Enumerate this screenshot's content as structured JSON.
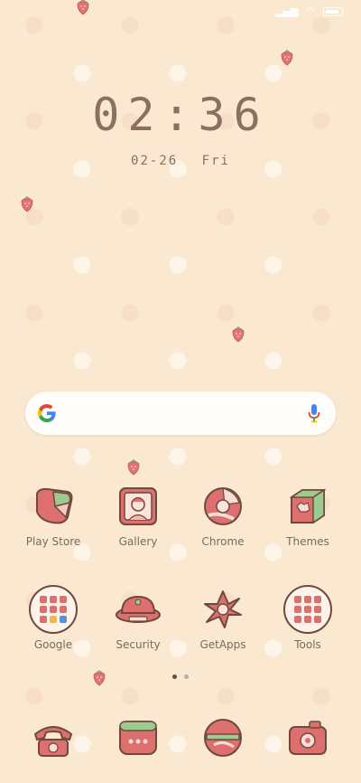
{
  "status_bar": {
    "signal_icon": "signal-icon",
    "wifi_icon": "wifi-icon",
    "battery_icon": "battery-icon"
  },
  "clock": {
    "time": "02:36",
    "date": "02-26",
    "weekday": "Fri"
  },
  "search": {
    "logo_icon": "google-g-icon",
    "mic_icon": "mic-icon"
  },
  "apps": [
    {
      "label": "Play Store",
      "icon": "play-store-icon"
    },
    {
      "label": "Gallery",
      "icon": "gallery-icon"
    },
    {
      "label": "Chrome",
      "icon": "chrome-icon"
    },
    {
      "label": "Themes",
      "icon": "themes-icon"
    },
    {
      "label": "Google",
      "icon": "google-folder-icon"
    },
    {
      "label": "Security",
      "icon": "security-icon"
    },
    {
      "label": "GetApps",
      "icon": "getapps-icon"
    },
    {
      "label": "Tools",
      "icon": "tools-folder-icon"
    }
  ],
  "page_indicator": {
    "pages": 2,
    "current": 1
  },
  "dock": [
    {
      "icon": "phone-icon"
    },
    {
      "icon": "messages-icon"
    },
    {
      "icon": "browser-icon"
    },
    {
      "icon": "camera-icon"
    }
  ],
  "colors": {
    "background": "#fae8d1",
    "accent": "#d96a6a",
    "green": "#8fbf8a",
    "text": "#7a6a60"
  }
}
